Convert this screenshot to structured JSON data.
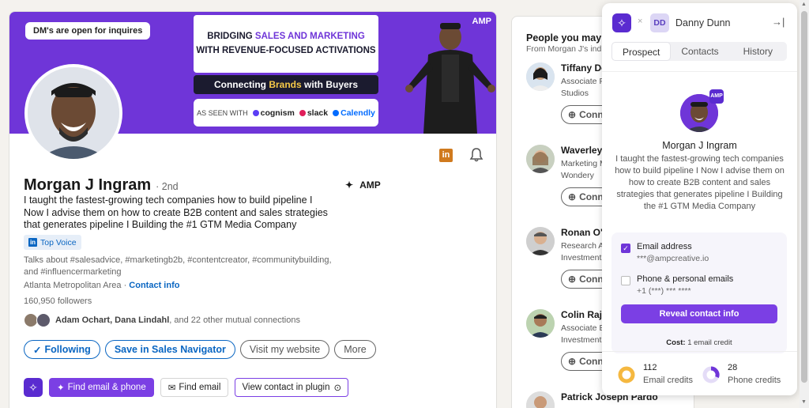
{
  "banner": {
    "dm_pill": "DM's are open for inquires",
    "headline_line1_a": "BRIDGING ",
    "headline_line1_b": "SALES AND MARKETING",
    "headline_line2": "WITH REVENUE-FOCUSED ACTIVATIONS",
    "tagline_a": "Connecting ",
    "tagline_b": "Brands",
    "tagline_c": " with Buyers",
    "as_seen_with": "AS SEEN WITH",
    "brands": [
      "cognism",
      "slack",
      "Calendly"
    ],
    "corner_logo": "AMP"
  },
  "profile": {
    "name": "Morgan J Ingram",
    "degree": "· 2nd",
    "company": "AMP",
    "headline": "I taught the fastest-growing tech companies how to build pipeline I Now I advise them on how to create B2B content and sales strategies that generates pipeline I Building the #1 GTM Media Company",
    "badge": "Top Voice",
    "talks_about": "Talks about #salesadvice, #marketingb2b, #contentcreator, #communitybuilding, and #influencermarketing",
    "location": "Atlanta Metropolitan Area · ",
    "contact_info": "Contact info",
    "followers": "160,950 followers",
    "mutual_names": "Adam Ochart, Dana Lindahl",
    "mutual_rest": ", and 22 other mutual connections",
    "actions": {
      "following": "Following",
      "sales_nav": "Save in Sales Navigator",
      "website": "Visit my website",
      "more": "More"
    },
    "plugin_actions": {
      "find_email_phone": "Find email & phone",
      "find_email": "Find email",
      "view_contact": "View contact in plugin"
    }
  },
  "pymk": {
    "title": "People you may k",
    "subtitle": "From Morgan J's ind",
    "connect_label": "Conn",
    "people": [
      {
        "name": "Tiffany Do",
        "role": "Associate P Studios"
      },
      {
        "name": "Waverley",
        "role": "Marketing M Wondery"
      },
      {
        "name": "Ronan O'E",
        "role": "Research Ar Investment"
      },
      {
        "name": "Colin Raja",
        "role": "Associate E Investment"
      },
      {
        "name": "Patrick Josepn Pardo",
        "role": ""
      }
    ]
  },
  "plugin": {
    "initials": "DD",
    "username": "Danny Dunn",
    "tabs": [
      "Prospect",
      "Contacts",
      "History"
    ],
    "active_tab": 0,
    "badge": "AMP",
    "name": "Morgan J Ingram",
    "headline": "I taught the fastest-growing tech companies how to build pipeline I Now I advise them on how to create B2B content and sales strategies that generates pipeline I Building the #1 GTM Media Company",
    "email_label": "Email address",
    "email_value": "***@ampcreative.io",
    "email_checked": true,
    "phone_label": "Phone & personal emails",
    "phone_value": "+1 (***) *** ****",
    "phone_checked": false,
    "reveal_button": "Reveal contact info",
    "cost_label": "Cost:",
    "cost_value": " 1 email credit",
    "email_credits": "112",
    "email_credits_label": "Email credits",
    "phone_credits": "28",
    "phone_credits_label": "Phone credits"
  },
  "colors": {
    "brand_purple": "#6f35d8",
    "button_purple": "#7b3fe4",
    "linkedin_blue": "#0a66c2",
    "email_credit": "#f5b840"
  }
}
